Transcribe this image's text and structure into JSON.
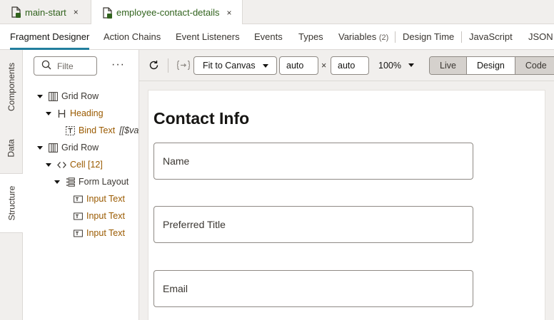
{
  "file_tabs": [
    {
      "name": "main-start",
      "close": "×"
    },
    {
      "name": "employee-contact-details",
      "close": "×"
    }
  ],
  "designer_tabs": {
    "fragment_designer": "Fragment Designer",
    "action_chains": "Action Chains",
    "event_listeners": "Event Listeners",
    "events": "Events",
    "types": "Types",
    "variables": "Variables",
    "variables_count": "(2)",
    "design_time": "Design Time",
    "javascript": "JavaScript",
    "json": "JSON"
  },
  "side_tabs": {
    "components": "Components",
    "data": "Data",
    "structure": "Structure"
  },
  "structure": {
    "filter_placeholder": "Filte",
    "more": "···",
    "tree": [
      {
        "label": "Grid Row",
        "icon": "grid-row-icon"
      },
      {
        "label": "Heading",
        "icon": "heading-icon"
      },
      {
        "label": "Bind Text",
        "value": "[[$va",
        "icon": "bind-text-icon"
      },
      {
        "label": "Grid Row",
        "icon": "grid-row-icon"
      },
      {
        "label": "Cell [12]",
        "icon": "cell-icon"
      },
      {
        "label": "Form Layout",
        "icon": "form-layout-icon"
      },
      {
        "label": "Input Text",
        "icon": "input-text-icon"
      },
      {
        "label": "Input Text",
        "icon": "input-text-icon"
      },
      {
        "label": "Input Text",
        "icon": "input-text-icon"
      }
    ]
  },
  "toolbar": {
    "fit": "Fit to Canvas",
    "width": "auto",
    "times": "×",
    "height": "auto",
    "zoom": "100%",
    "modes": [
      "Live",
      "Design",
      "Code"
    ]
  },
  "canvas": {
    "title": "Contact Info",
    "fields": [
      "Name",
      "Preferred Title",
      "Email"
    ]
  },
  "colors": {
    "accent": "#227e9e",
    "brand_green": "#31631d",
    "component_label": "#9a5a00"
  }
}
